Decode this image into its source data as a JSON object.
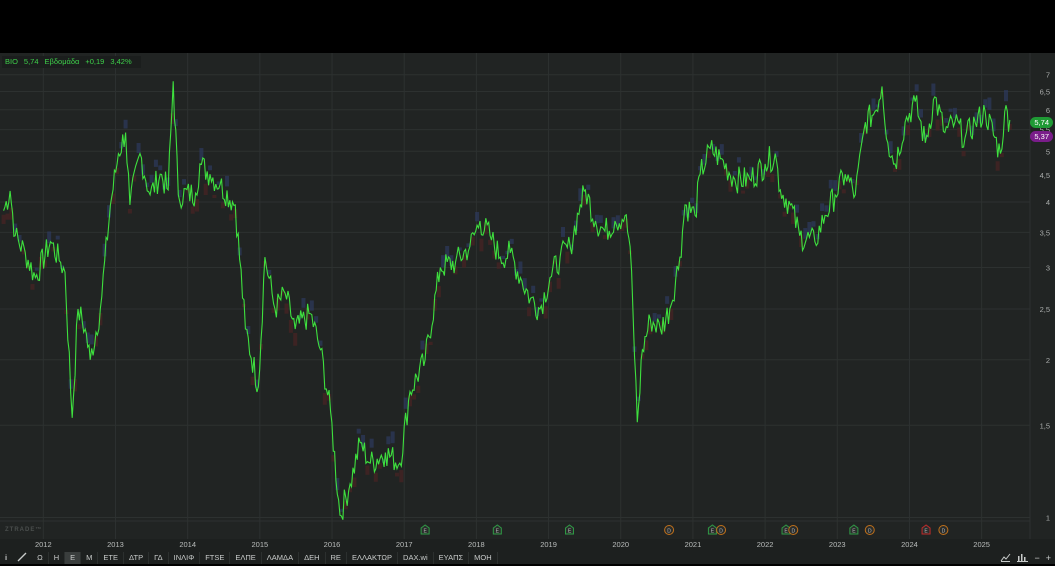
{
  "legend": {
    "symbol": "ΒΙΟ",
    "last": "5,74",
    "period": "Εβδομάδα",
    "change": "+0,19",
    "change_pct": "3,42%"
  },
  "badges": {
    "last_price": "5,74",
    "last_color": "#1f9a35",
    "ref_price": "5,37",
    "ref_color": "#7a1d8a"
  },
  "watermark": "ZTRADE™",
  "toolbar": {
    "info_icon": "info-icon",
    "draw_icon": "pen-line-icon",
    "periods": [
      "Ω",
      "Η",
      "Ε",
      "Μ"
    ],
    "active_period": "Ε",
    "symbols": [
      "ΕΤΕ",
      "ΔΤΡ",
      "ΓΔ",
      "ΙΝΛΙΦ",
      "FTSE",
      "ΕΛΠΕ",
      "ΛΑΜΔΑ",
      "ΔΕΗ",
      "RE",
      "ΕΛΛΑΚΤΩΡ",
      "DAX.wi",
      "ΕΥΑΠΣ",
      "ΜΟΗ"
    ],
    "right_icons": [
      "chart-type-icon",
      "volume-bars-icon",
      "zoom-out-icon",
      "zoom-in-icon"
    ],
    "minus": "−",
    "plus": "+"
  },
  "chart_data": {
    "type": "line",
    "title": "ΒΙΟ Εβδομάδα",
    "scale": "log",
    "xlim": [
      2011.4,
      2025.67
    ],
    "ylim": [
      0.91,
      7.7
    ],
    "x_ticks": [
      2012,
      2013,
      2014,
      2015,
      2016,
      2017,
      2018,
      2019,
      2020,
      2021,
      2022,
      2023,
      2024,
      2025
    ],
    "y_ticks": [
      1,
      1.5,
      2,
      2.5,
      3,
      3.5,
      4,
      4.5,
      5,
      5.5,
      6,
      6.5,
      7
    ],
    "y_tick_labels": [
      "1",
      "1,5",
      "2",
      "2,5",
      "3",
      "3,5",
      "4",
      "4,5",
      "5",
      "5,5",
      "6",
      "6,5",
      "7"
    ],
    "line_color": "#3ee03e",
    "series": [
      {
        "name": "ΒΙΟ",
        "points": [
          [
            2011.45,
            3.85
          ],
          [
            2011.54,
            4.2
          ],
          [
            2011.61,
            3.45
          ],
          [
            2011.75,
            3.2
          ],
          [
            2011.89,
            2.87
          ],
          [
            2012.1,
            3.36
          ],
          [
            2012.24,
            3.07
          ],
          [
            2012.3,
            2.94
          ],
          [
            2012.4,
            1.55
          ],
          [
            2012.48,
            2.5
          ],
          [
            2012.58,
            2.29
          ],
          [
            2012.65,
            2.0
          ],
          [
            2012.79,
            2.5
          ],
          [
            2012.93,
            3.95
          ],
          [
            2013.04,
            4.95
          ],
          [
            2013.14,
            5.43
          ],
          [
            2013.2,
            3.95
          ],
          [
            2013.34,
            4.95
          ],
          [
            2013.48,
            4.13
          ],
          [
            2013.62,
            4.52
          ],
          [
            2013.73,
            4.22
          ],
          [
            2013.8,
            6.8
          ],
          [
            2013.87,
            4.13
          ],
          [
            2014.11,
            4.16
          ],
          [
            2014.17,
            4.73
          ],
          [
            2014.31,
            4.52
          ],
          [
            2014.45,
            4.32
          ],
          [
            2014.66,
            3.95
          ],
          [
            2014.8,
            2.29
          ],
          [
            2014.98,
            1.78
          ],
          [
            2015.07,
            3.14
          ],
          [
            2015.21,
            2.5
          ],
          [
            2015.35,
            2.68
          ],
          [
            2015.49,
            2.29
          ],
          [
            2015.7,
            2.45
          ],
          [
            2015.84,
            2.09
          ],
          [
            2015.98,
            1.59
          ],
          [
            2016.11,
            1.01
          ],
          [
            2016.25,
            1.16
          ],
          [
            2016.39,
            1.39
          ],
          [
            2016.53,
            1.27
          ],
          [
            2016.74,
            1.33
          ],
          [
            2016.94,
            1.27
          ],
          [
            2017.08,
            1.74
          ],
          [
            2017.29,
            2.0
          ],
          [
            2017.5,
            3.0
          ],
          [
            2017.71,
            3.07
          ],
          [
            2017.91,
            3.29
          ],
          [
            2018.05,
            3.68
          ],
          [
            2018.19,
            3.45
          ],
          [
            2018.33,
            3.14
          ],
          [
            2018.47,
            3.2
          ],
          [
            2018.61,
            2.87
          ],
          [
            2018.75,
            2.62
          ],
          [
            2018.88,
            2.5
          ],
          [
            2019.02,
            2.87
          ],
          [
            2019.16,
            3.14
          ],
          [
            2019.3,
            3.29
          ],
          [
            2019.44,
            3.95
          ],
          [
            2019.51,
            4.22
          ],
          [
            2019.65,
            3.68
          ],
          [
            2019.78,
            3.52
          ],
          [
            2019.92,
            3.68
          ],
          [
            2020.06,
            3.77
          ],
          [
            2020.13,
            3.29
          ],
          [
            2020.23,
            1.52
          ],
          [
            2020.3,
            2.09
          ],
          [
            2020.41,
            2.39
          ],
          [
            2020.55,
            2.29
          ],
          [
            2020.68,
            2.5
          ],
          [
            2020.82,
            3.14
          ],
          [
            2020.89,
            3.95
          ],
          [
            2021.03,
            3.77
          ],
          [
            2021.1,
            4.52
          ],
          [
            2021.24,
            5.06
          ],
          [
            2021.38,
            4.84
          ],
          [
            2021.58,
            4.42
          ],
          [
            2021.79,
            4.42
          ],
          [
            2022.0,
            4.73
          ],
          [
            2022.14,
            4.95
          ],
          [
            2022.21,
            4.22
          ],
          [
            2022.35,
            3.95
          ],
          [
            2022.48,
            3.45
          ],
          [
            2022.69,
            3.36
          ],
          [
            2022.83,
            3.77
          ],
          [
            2022.97,
            4.13
          ],
          [
            2023.11,
            4.52
          ],
          [
            2023.25,
            4.13
          ],
          [
            2023.39,
            5.68
          ],
          [
            2023.52,
            5.95
          ],
          [
            2023.62,
            6.65
          ],
          [
            2023.7,
            5.19
          ],
          [
            2023.8,
            4.73
          ],
          [
            2023.94,
            5.68
          ],
          [
            2024.08,
            6.22
          ],
          [
            2024.22,
            5.19
          ],
          [
            2024.35,
            6.35
          ],
          [
            2024.49,
            5.43
          ],
          [
            2024.63,
            5.68
          ],
          [
            2024.77,
            5.3
          ],
          [
            2024.91,
            5.68
          ],
          [
            2025.05,
            5.95
          ],
          [
            2025.26,
            4.95
          ],
          [
            2025.32,
            5.95
          ],
          [
            2025.39,
            5.74
          ]
        ]
      }
    ],
    "events": [
      {
        "x": 2017.29,
        "label": "E",
        "kind": "earnings",
        "color": "#2f9a45"
      },
      {
        "x": 2018.29,
        "label": "E",
        "kind": "earnings",
        "color": "#2f9a45"
      },
      {
        "x": 2019.29,
        "label": "E",
        "kind": "earnings",
        "color": "#2f9a45"
      },
      {
        "x": 2020.67,
        "label": "D",
        "kind": "dividend",
        "color": "#c0701a"
      },
      {
        "x": 2021.27,
        "label": "E",
        "kind": "earnings",
        "color": "#2f9a45"
      },
      {
        "x": 2021.39,
        "label": "D",
        "kind": "dividend",
        "color": "#c0701a"
      },
      {
        "x": 2022.29,
        "label": "E",
        "kind": "earnings",
        "color": "#2f9a45"
      },
      {
        "x": 2022.39,
        "label": "D",
        "kind": "dividend",
        "color": "#c0701a"
      },
      {
        "x": 2023.23,
        "label": "E",
        "kind": "earnings",
        "color": "#2f9a45"
      },
      {
        "x": 2023.45,
        "label": "D",
        "kind": "dividend",
        "color": "#c0701a"
      },
      {
        "x": 2024.23,
        "label": "E",
        "kind": "earnings",
        "color": "#c02a2a"
      },
      {
        "x": 2024.47,
        "label": "D",
        "kind": "dividend",
        "color": "#c0701a"
      }
    ]
  }
}
